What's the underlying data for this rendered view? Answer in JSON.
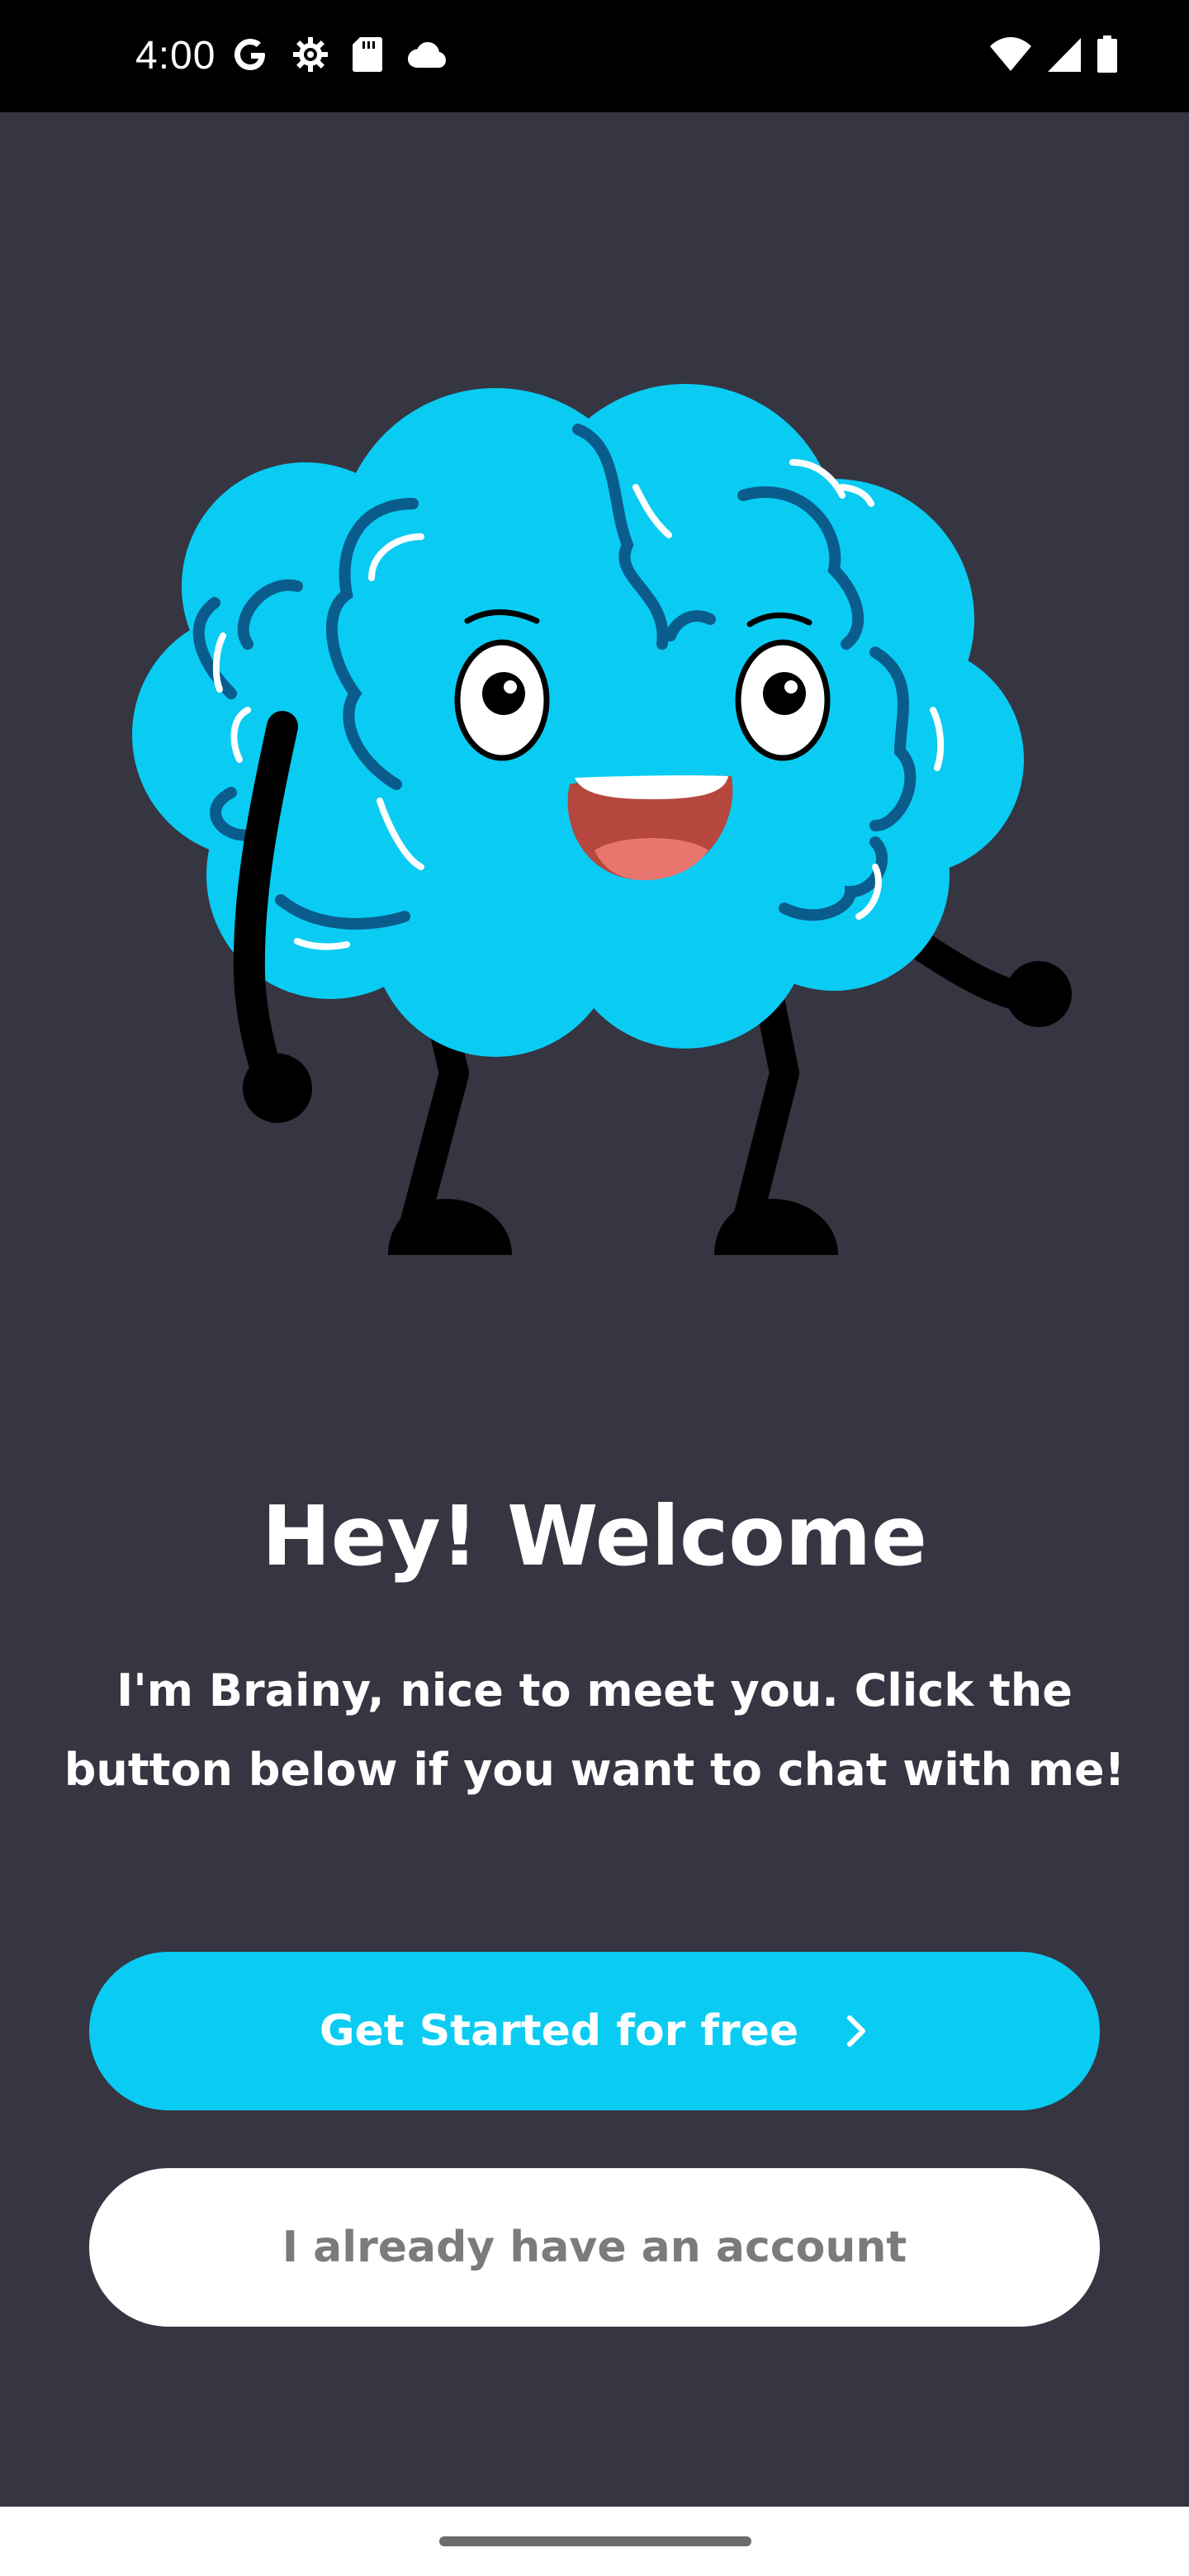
{
  "status_bar": {
    "time": "4:00",
    "left_icons": [
      "google-icon",
      "settings-icon",
      "sd-card-icon",
      "cloud-icon"
    ],
    "right_icons": [
      "wifi-icon",
      "cellular-signal-icon",
      "battery-icon"
    ]
  },
  "illustration": {
    "subject": "brain-mascot",
    "colors": {
      "brain": "#0ACCF3",
      "brain_lines": "#0A5C8C",
      "limbs": "#000000",
      "mouth": "#B5473E",
      "tongue": "#E8766F"
    }
  },
  "welcome": {
    "title": "Hey! Welcome",
    "subtitle": "I'm Brainy, nice to meet you. Click the button below if you want to chat with me!"
  },
  "actions": {
    "primary_label": "Get Started for free",
    "primary_icon": "chevron-right-icon",
    "secondary_label": "I already have an account"
  },
  "colors": {
    "background": "#363542",
    "accent": "#0ACCF3",
    "secondary_button_bg": "#FFFFFF",
    "secondary_button_text": "#7B7B7E"
  }
}
